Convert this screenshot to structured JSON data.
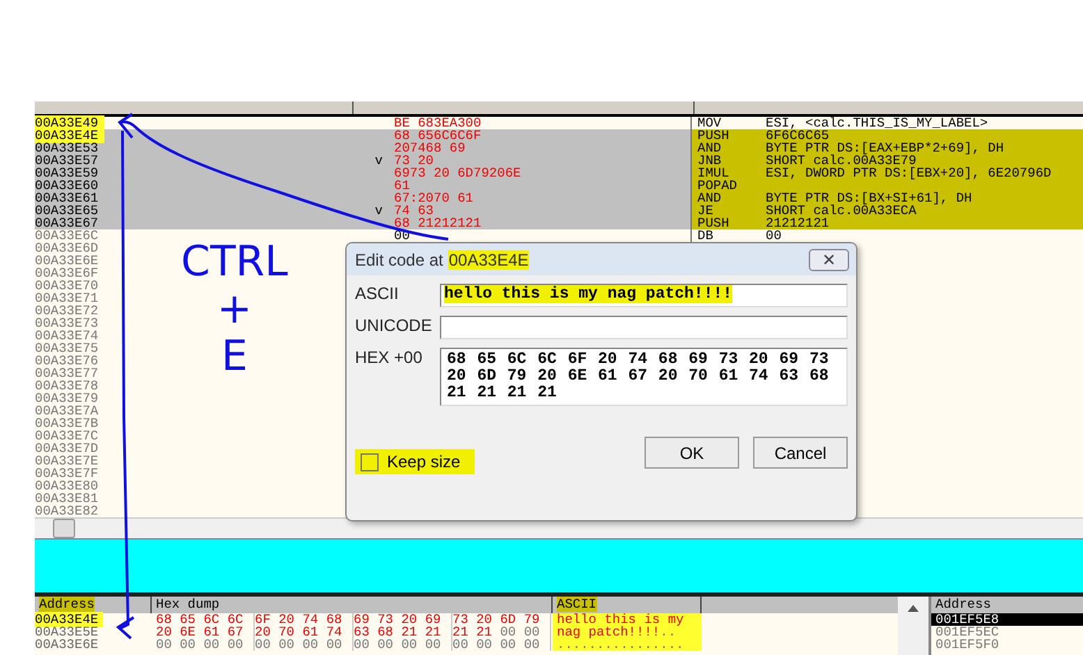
{
  "cpu": {
    "rows": [
      {
        "address": "00A33E49",
        "jump": "",
        "hex": "BE 683EA300",
        "mnemonic": "MOV",
        "operands": "ESI, <calc.THIS_IS_MY_LABEL>",
        "selected": false,
        "modified": true,
        "dimmed": false,
        "address_highlighted": true,
        "code_highlighted": false
      },
      {
        "address": "00A33E4E",
        "jump": "",
        "hex": "68 656C6C6F",
        "mnemonic": "PUSH",
        "operands": "6F6C6C65",
        "selected": true,
        "modified": true,
        "dimmed": false,
        "address_highlighted": true,
        "code_highlighted": true
      },
      {
        "address": "00A33E53",
        "jump": "",
        "hex": "207468 69",
        "mnemonic": "AND",
        "operands": "BYTE PTR DS:[EAX+EBP*2+69], DH",
        "selected": true,
        "modified": true,
        "dimmed": false,
        "address_highlighted": false,
        "code_highlighted": true
      },
      {
        "address": "00A33E57",
        "jump": "v",
        "hex": "73 20",
        "mnemonic": "JNB",
        "operands": "SHORT calc.00A33E79",
        "selected": true,
        "modified": true,
        "dimmed": false,
        "address_highlighted": false,
        "code_highlighted": true
      },
      {
        "address": "00A33E59",
        "jump": "",
        "hex": "6973 20 6D79206E",
        "mnemonic": "IMUL",
        "operands": "ESI, DWORD PTR DS:[EBX+20], 6E20796D",
        "selected": true,
        "modified": true,
        "dimmed": false,
        "address_highlighted": false,
        "code_highlighted": true
      },
      {
        "address": "00A33E60",
        "jump": "",
        "hex": "61",
        "mnemonic": "POPAD",
        "operands": "",
        "selected": true,
        "modified": true,
        "dimmed": false,
        "address_highlighted": false,
        "code_highlighted": true
      },
      {
        "address": "00A33E61",
        "jump": "",
        "hex": "67:2070 61",
        "mnemonic": "AND",
        "operands": "BYTE PTR DS:[BX+SI+61], DH",
        "selected": true,
        "modified": true,
        "dimmed": false,
        "address_highlighted": false,
        "code_highlighted": true
      },
      {
        "address": "00A33E65",
        "jump": "v",
        "hex": "74 63",
        "mnemonic": "JE",
        "operands": "SHORT calc.00A33ECA",
        "selected": true,
        "modified": true,
        "dimmed": false,
        "address_highlighted": false,
        "code_highlighted": true
      },
      {
        "address": "00A33E67",
        "jump": "",
        "hex": "68 21212121",
        "mnemonic": "PUSH",
        "operands": "21212121",
        "selected": true,
        "modified": true,
        "dimmed": false,
        "address_highlighted": false,
        "code_highlighted": true
      },
      {
        "address": "00A33E6C",
        "jump": "",
        "hex": "00",
        "mnemonic": "DB",
        "operands": "00",
        "selected": false,
        "modified": false,
        "dimmed": true,
        "address_highlighted": false,
        "code_highlighted": false
      },
      {
        "address": "00A33E6D",
        "dimmed": true
      },
      {
        "address": "00A33E6E",
        "dimmed": true
      },
      {
        "address": "00A33E6F",
        "dimmed": true
      },
      {
        "address": "00A33E70",
        "dimmed": true
      },
      {
        "address": "00A33E71",
        "dimmed": true
      },
      {
        "address": "00A33E72",
        "dimmed": true
      },
      {
        "address": "00A33E73",
        "dimmed": true
      },
      {
        "address": "00A33E74",
        "dimmed": true
      },
      {
        "address": "00A33E75",
        "dimmed": true
      },
      {
        "address": "00A33E76",
        "dimmed": true
      },
      {
        "address": "00A33E77",
        "dimmed": true
      },
      {
        "address": "00A33E78",
        "dimmed": true
      },
      {
        "address": "00A33E79",
        "dimmed": true
      },
      {
        "address": "00A33E7A",
        "dimmed": true
      },
      {
        "address": "00A33E7B",
        "dimmed": true
      },
      {
        "address": "00A33E7C",
        "dimmed": true
      },
      {
        "address": "00A33E7D",
        "dimmed": true
      },
      {
        "address": "00A33E7E",
        "dimmed": true
      },
      {
        "address": "00A33E7F",
        "dimmed": true
      },
      {
        "address": "00A33E80",
        "dimmed": true
      },
      {
        "address": "00A33E81",
        "dimmed": true
      },
      {
        "address": "00A33E82",
        "dimmed": true
      }
    ]
  },
  "dialog": {
    "title": "Edit code at",
    "address": "00A33E4E",
    "address_highlighted": true,
    "close": "✕",
    "fields": [
      {
        "label": "ASCII",
        "value": "hello this is my nag patch!!!!",
        "highlighted": true,
        "kind": "line"
      },
      {
        "label": "UNICODE",
        "highlighted": false,
        "kind": "line"
      },
      {
        "label": "HEX +00",
        "value": "68 65 6C 6C 6F 20 74 68 69 73 20 69 73 20 6D 79 20 6E 61 67 20 70 61 74 63 68 21 21 21 21",
        "highlighted": false,
        "kind": "box"
      }
    ],
    "keep_size": {
      "label": "Keep size",
      "checked": false,
      "highlighted": true
    },
    "buttons": [
      "OK",
      "Cancel"
    ]
  },
  "dump": {
    "columns": [
      {
        "label": "Address",
        "highlighted": true
      },
      {
        "label": "Hex dump",
        "highlighted": false
      },
      {
        "label": "ASCII",
        "highlighted": true
      }
    ],
    "rows": [
      {
        "address": "00A33E4E",
        "address_highlighted": true,
        "hex_modified": "68 65 6C 6C 6F 20 74 68 69 73 20 69 73 20 6D 79",
        "hex_rest": "",
        "ascii_modified": "hello this is my",
        "ascii_rest": ""
      },
      {
        "address": "00A33E5E",
        "address_highlighted": false,
        "hex_modified": "20 6E 61 67 20 70 61 74 63 68 21 21 21 21",
        "hex_rest": "00 00",
        "ascii_modified": "nag patch!!!!",
        "ascii_rest": ".."
      },
      {
        "address": "00A33E6E",
        "address_highlighted": false,
        "hex_modified": "",
        "hex_rest": "00 00 00 00 00 00 00 00 00 00 00 00 00 00 00 00",
        "ascii_modified": "",
        "ascii_rest": "................"
      }
    ]
  },
  "stack": {
    "column": "Address",
    "rows": [
      {
        "address": "001EF5E8",
        "selected": true
      },
      {
        "address": "001EF5EC",
        "selected": false
      },
      {
        "address": "001EF5F0",
        "selected": false
      }
    ]
  },
  "annotation": {
    "lines": [
      "CTRL",
      "+",
      "E"
    ]
  }
}
